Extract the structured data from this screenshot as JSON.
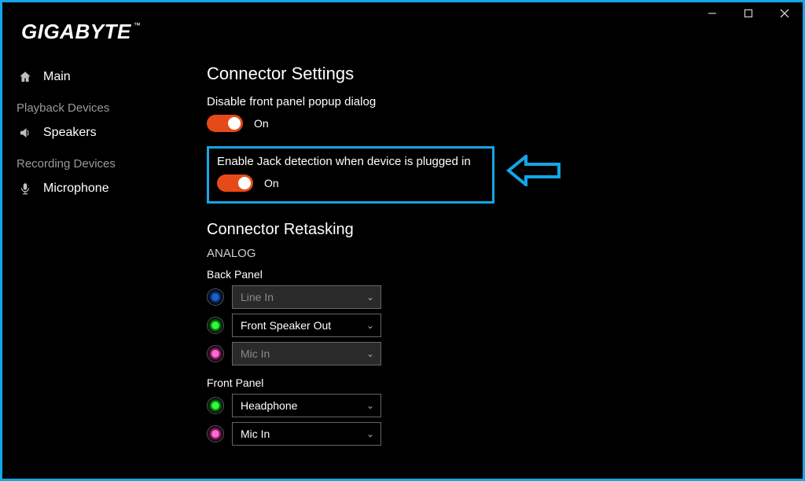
{
  "brand": "GIGABYTE",
  "brand_tm": "™",
  "sidebar": {
    "main": "Main",
    "playback_header": "Playback Devices",
    "speakers": "Speakers",
    "recording_header": "Recording Devices",
    "microphone": "Microphone"
  },
  "content": {
    "settings_title": "Connector Settings",
    "disable_popup_label": "Disable front panel popup dialog",
    "disable_popup_state": "On",
    "jack_detect_label": "Enable Jack detection when device is plugged in",
    "jack_detect_state": "On",
    "retasking_title": "Connector Retasking",
    "analog_label": "ANALOG",
    "back_panel_label": "Back Panel",
    "front_panel_label": "Front Panel",
    "back_panel": [
      {
        "color": "blue",
        "value": "Line In",
        "enabled": false
      },
      {
        "color": "green",
        "value": "Front Speaker Out",
        "enabled": true
      },
      {
        "color": "pink",
        "value": "Mic In",
        "enabled": false
      }
    ],
    "front_panel": [
      {
        "color": "green",
        "value": "Headphone",
        "enabled": true
      },
      {
        "color": "pink",
        "value": "Mic In",
        "enabled": true
      }
    ]
  },
  "colors": {
    "accent_border": "#14a6e6",
    "toggle_on": "#e64a19",
    "jack_blue_c1": "#1a5fd0",
    "jack_blue_c2": "#0b2a60",
    "jack_green_c1": "#2aff3a",
    "jack_green_c2": "#0a6a12",
    "jack_pink_c1": "#ff6ad0",
    "jack_pink_c2": "#7a1a55"
  }
}
